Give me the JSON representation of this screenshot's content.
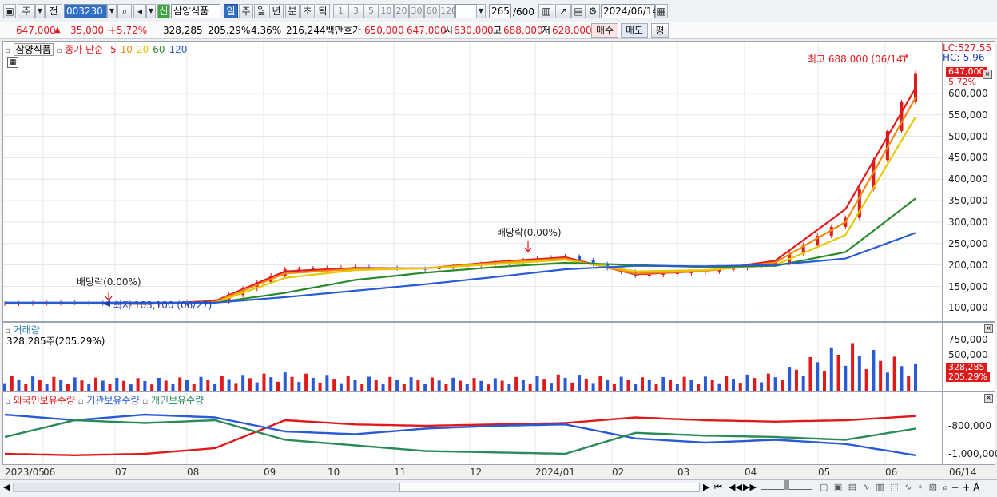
{
  "toolbar": {
    "mode_label": "주",
    "prev_label": "전",
    "stock_code": "003230",
    "badge": "신",
    "stock_name": "삼양식품",
    "periods": [
      "일",
      "주",
      "월",
      "년",
      "분",
      "초",
      "틱"
    ],
    "intervals": [
      "1",
      "3",
      "5",
      "10",
      "20",
      "30",
      "60",
      "120"
    ],
    "count": "265",
    "count_total": "/600",
    "date": "2024/06/14"
  },
  "infobar": {
    "price": "647,000",
    "change": "35,000",
    "change_pct": "+5.72%",
    "volume": "328,285",
    "vol_ratio": "205.29%",
    "turnover": "4.36%",
    "amount": "216,244백만",
    "ask_label": "호가",
    "ask1": "650,000",
    "ask2": "647,000",
    "open_label": "시",
    "open": "630,000",
    "high_label": "고",
    "high": "688,000",
    "low_label": "저",
    "low": "628,000",
    "buy": "매수",
    "sell": "매도",
    "avg": "평"
  },
  "price_panel": {
    "stock_tag": "삼양식품",
    "ma_label": "종가 단순",
    "ma_periods": [
      "5",
      "10",
      "20",
      "60",
      "120"
    ],
    "ma_colors": [
      "#e0191b",
      "#f08a10",
      "#e6c800",
      "#2a8a2a",
      "#2a5bd7"
    ],
    "high_note": "최고 688,000 (06/14)",
    "low_note": "최저 103,100 (06/27)",
    "dividend1": "배당락(0.00%)",
    "dividend2": "배당락(0.00%)",
    "lc": "LC:527.55",
    "hc": "HC:-5.96",
    "price_tag": "647,000",
    "pct_tag": "5.72%",
    "y_ticks": [
      "600,000",
      "550,000",
      "500,000",
      "450,000",
      "400,000",
      "350,000",
      "300,000",
      "250,000",
      "200,000",
      "150,000",
      "100,000"
    ]
  },
  "volume_panel": {
    "title": "거래량",
    "value": "328,285주(205.29%)",
    "y_ticks": [
      "750,000",
      "500,000",
      "250,000"
    ],
    "vol_tag": "328,285",
    "pct_tag": "205.29%"
  },
  "holding_panel": {
    "series": [
      "외국인보유수량",
      "기관보유수량",
      "개인보유수량"
    ],
    "series_colors": [
      "#e0191b",
      "#2a5bd7",
      "#2a8a5a"
    ],
    "y_ticks": [
      "-800,000",
      "-1,000,000"
    ]
  },
  "x_axis": [
    "2023/05",
    "06",
    "07",
    "08",
    "09",
    "10",
    "11",
    "12",
    "2024/01",
    "02",
    "03",
    "04",
    "05",
    "06"
  ],
  "x_axis_right": "06/14",
  "chart_data": {
    "type": "line",
    "title": "삼양식품",
    "x": [
      "2023/05",
      "2023/06",
      "2023/07",
      "2023/08",
      "2023/09",
      "2023/10",
      "2023/11",
      "2023/12",
      "2024/01",
      "2024/02",
      "2024/03",
      "2024/04",
      "2024/05",
      "2024/06"
    ],
    "series": [
      {
        "name": "종가",
        "values": [
          110000,
          112000,
          108000,
          115000,
          190000,
          195000,
          190000,
          205000,
          220000,
          175000,
          185000,
          205000,
          310000,
          647000
        ]
      },
      {
        "name": "5",
        "values": [
          110000,
          111000,
          109000,
          116000,
          185000,
          193000,
          192000,
          207000,
          218000,
          178000,
          186000,
          210000,
          330000,
          612000
        ]
      },
      {
        "name": "10",
        "values": [
          110000,
          111000,
          110000,
          114000,
          180000,
          191000,
          192000,
          205000,
          215000,
          180000,
          186000,
          206000,
          300000,
          590000
        ]
      },
      {
        "name": "20",
        "values": [
          110000,
          110000,
          110000,
          112000,
          170000,
          188000,
          192000,
          202000,
          212000,
          185000,
          188000,
          200000,
          270000,
          545000
        ]
      },
      {
        "name": "60",
        "values": [
          112000,
          112000,
          112000,
          112000,
          135000,
          165000,
          182000,
          195000,
          205000,
          200000,
          195000,
          198000,
          230000,
          355000
        ]
      },
      {
        "name": "120",
        "values": [
          112000,
          112000,
          112000,
          112000,
          125000,
          140000,
          155000,
          172000,
          190000,
          198000,
          197000,
          200000,
          215000,
          275000
        ]
      }
    ],
    "ylim": [
      80000,
      700000
    ],
    "volume": [
      180000,
      160000,
      150000,
      170000,
      220000,
      170000,
      160000,
      150000,
      200000,
      160000,
      170000,
      210000,
      600000,
      328285
    ],
    "foreign_holding": [
      -1000000,
      -1010000,
      -1000000,
      -960000,
      -760000,
      -790000,
      -800000,
      -790000,
      -780000,
      -740000,
      -760000,
      -770000,
      -760000,
      -730000
    ],
    "inst_holding": [
      -720000,
      -760000,
      -720000,
      -740000,
      -840000,
      -860000,
      -820000,
      -800000,
      -790000,
      -890000,
      -920000,
      -900000,
      -930000,
      -1010000
    ],
    "retail_holding": [
      -880000,
      -760000,
      -780000,
      -760000,
      -900000,
      -940000,
      -980000,
      -990000,
      -1000000,
      -850000,
      -870000,
      -880000,
      -900000,
      -820000
    ]
  }
}
